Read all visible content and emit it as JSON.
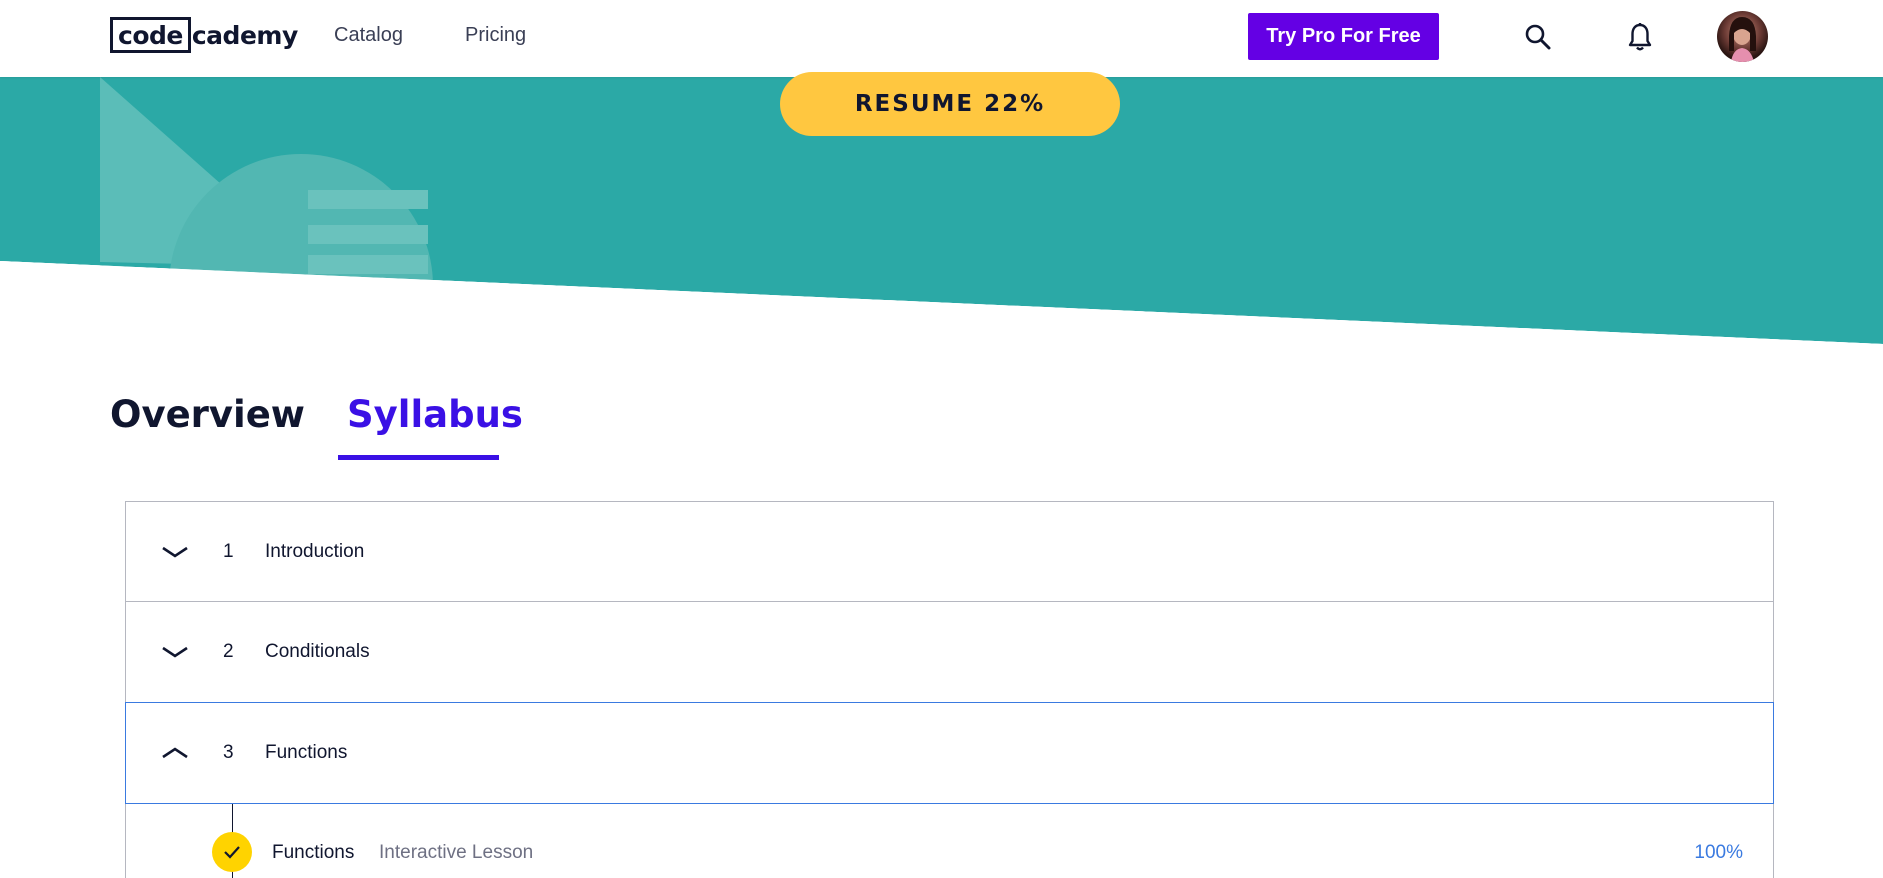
{
  "header": {
    "logo_code": "code",
    "logo_rest": "cademy",
    "nav": {
      "catalog": "Catalog",
      "pricing": "Pricing"
    },
    "try_pro": "Try Pro For Free",
    "icons": {
      "search": "search-icon",
      "notifications": "bell-icon",
      "avatar": "user-avatar"
    }
  },
  "hero": {
    "resume_label": "RESUME 22%",
    "progress_percent": 22,
    "colors": {
      "background": "#2ba9a6",
      "button": "#ffc740"
    }
  },
  "tabs": [
    {
      "label": "Overview",
      "active": false
    },
    {
      "label": "Syllabus",
      "active": true
    }
  ],
  "syllabus": {
    "modules": [
      {
        "number": "1",
        "title": "Introduction",
        "expanded": false
      },
      {
        "number": "2",
        "title": "Conditionals",
        "expanded": false
      },
      {
        "number": "3",
        "title": "Functions",
        "expanded": true
      }
    ],
    "lessons": [
      {
        "title": "Functions",
        "type": "Interactive Lesson",
        "progress": "100%",
        "completed": true
      }
    ]
  },
  "colors": {
    "accent": "#3a10e5",
    "cta": "#6400e4",
    "link_blue": "#3a7ae0",
    "check_yellow": "#ffd300"
  }
}
